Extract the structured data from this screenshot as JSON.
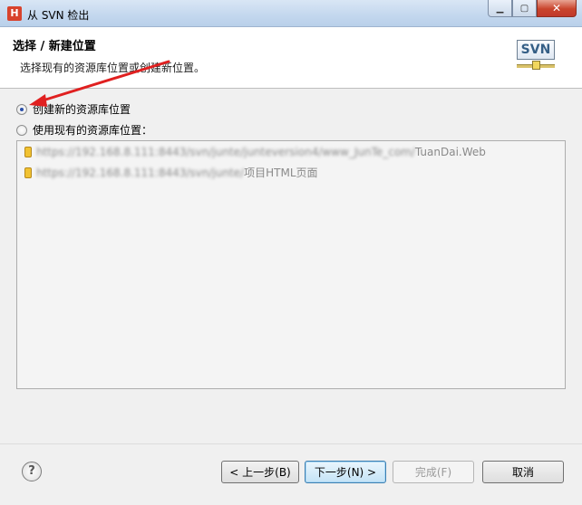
{
  "window": {
    "icon_letter": "H",
    "title": "从 SVN 检出",
    "minimize": "▁",
    "maximize": "▢",
    "close": "✕"
  },
  "header": {
    "title": "选择 / 新建位置",
    "description": "选择现有的资源库位置或创建新位置。",
    "logo_text": "SVN"
  },
  "options": {
    "create_new": {
      "label": "创建新的资源库位置",
      "checked": true
    },
    "use_existing": {
      "label": "使用现有的资源库位置：",
      "checked": false
    }
  },
  "repositories": [
    {
      "url_prefix": "https://192.168.8.111:8443/svn/junte/junteversion4/www_JunTe_com/",
      "url_suffix": "TuanDai.Web"
    },
    {
      "url_prefix": "https://192.168.8.111:8443/svn/junte/",
      "url_suffix": "项目HTML页面"
    }
  ],
  "buttons": {
    "help": "?",
    "back": "< 上一步(B)",
    "next": "下一步(N) >",
    "finish": "完成(F)",
    "cancel": "取消"
  },
  "colors": {
    "annotation_arrow": "#e02020",
    "focus_button": "#3c7fb1"
  }
}
